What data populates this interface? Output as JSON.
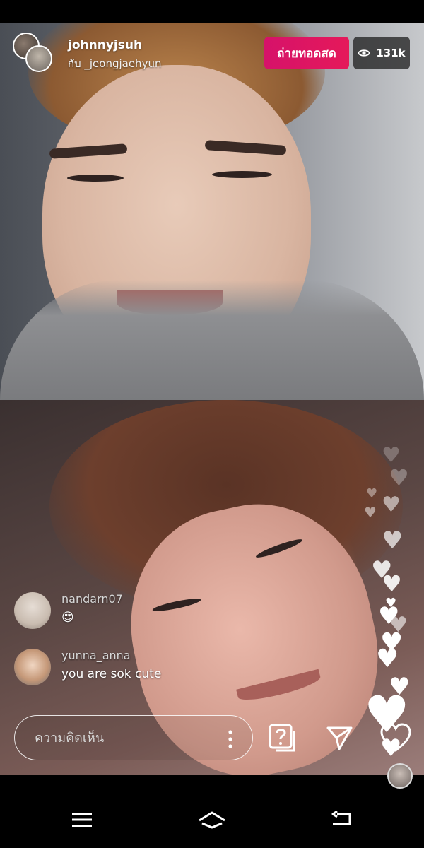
{
  "header": {
    "host_username": "johnnyjsuh",
    "guest_line": "กับ _jeongjaehyun",
    "live_badge": "ถ่ายทอดสด",
    "viewer_count": "131k"
  },
  "comments": [
    {
      "username": "nandarn07",
      "text": "😍"
    },
    {
      "username": "yunna_anna",
      "text": "you are sok cute"
    }
  ],
  "composer": {
    "placeholder": "ความคิดเห็น"
  },
  "icons": {
    "viewers": "eye-icon",
    "more": "more-vertical-icon",
    "question": "question-box-icon",
    "share": "paper-plane-icon",
    "like": "heart-icon"
  },
  "colors": {
    "live_badge": "#d6126a",
    "viewer_badge_bg": "#1e1e1e"
  }
}
